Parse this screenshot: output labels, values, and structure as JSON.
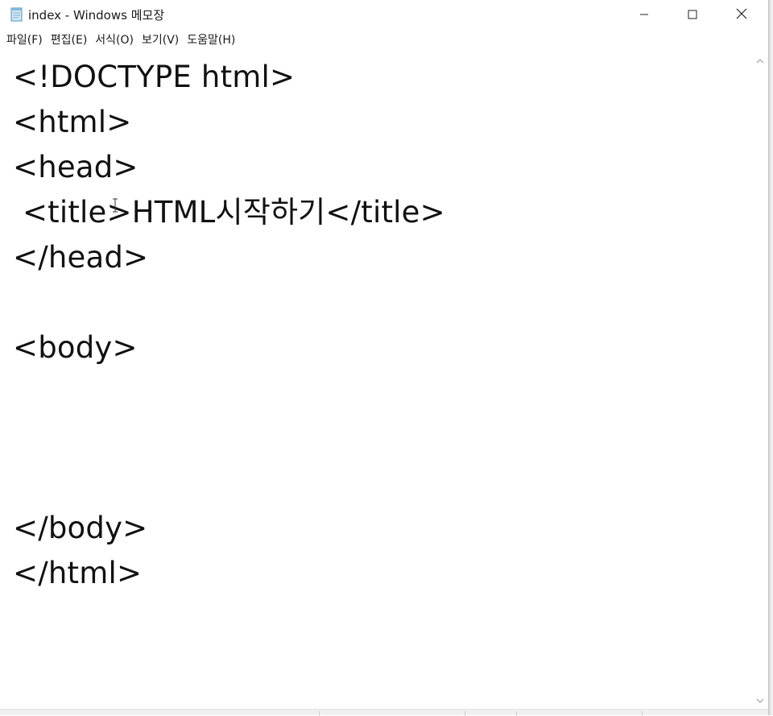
{
  "window": {
    "title": "index - Windows 메모장"
  },
  "menu": {
    "items": [
      {
        "label": "파일(F)"
      },
      {
        "label": "편집(E)"
      },
      {
        "label": "서식(O)"
      },
      {
        "label": "보기(V)"
      },
      {
        "label": "도움말(H)"
      }
    ]
  },
  "editor": {
    "lines": [
      "<!DOCTYPE html>",
      "<html>",
      "<head>",
      " <title>HTML시작하기</title>",
      "</head>",
      "",
      "<body>",
      "",
      "",
      "",
      "</body>",
      "</html>"
    ]
  },
  "icons": {
    "app": "notepad-icon",
    "minimize": "minimize-icon",
    "maximize": "maximize-icon",
    "close": "close-icon",
    "scroll_up": "chevron-up-icon",
    "scroll_down": "chevron-down-icon"
  },
  "colors": {
    "background": "#ffffff",
    "text": "#111111",
    "status_bar": "#f0f0f0"
  }
}
